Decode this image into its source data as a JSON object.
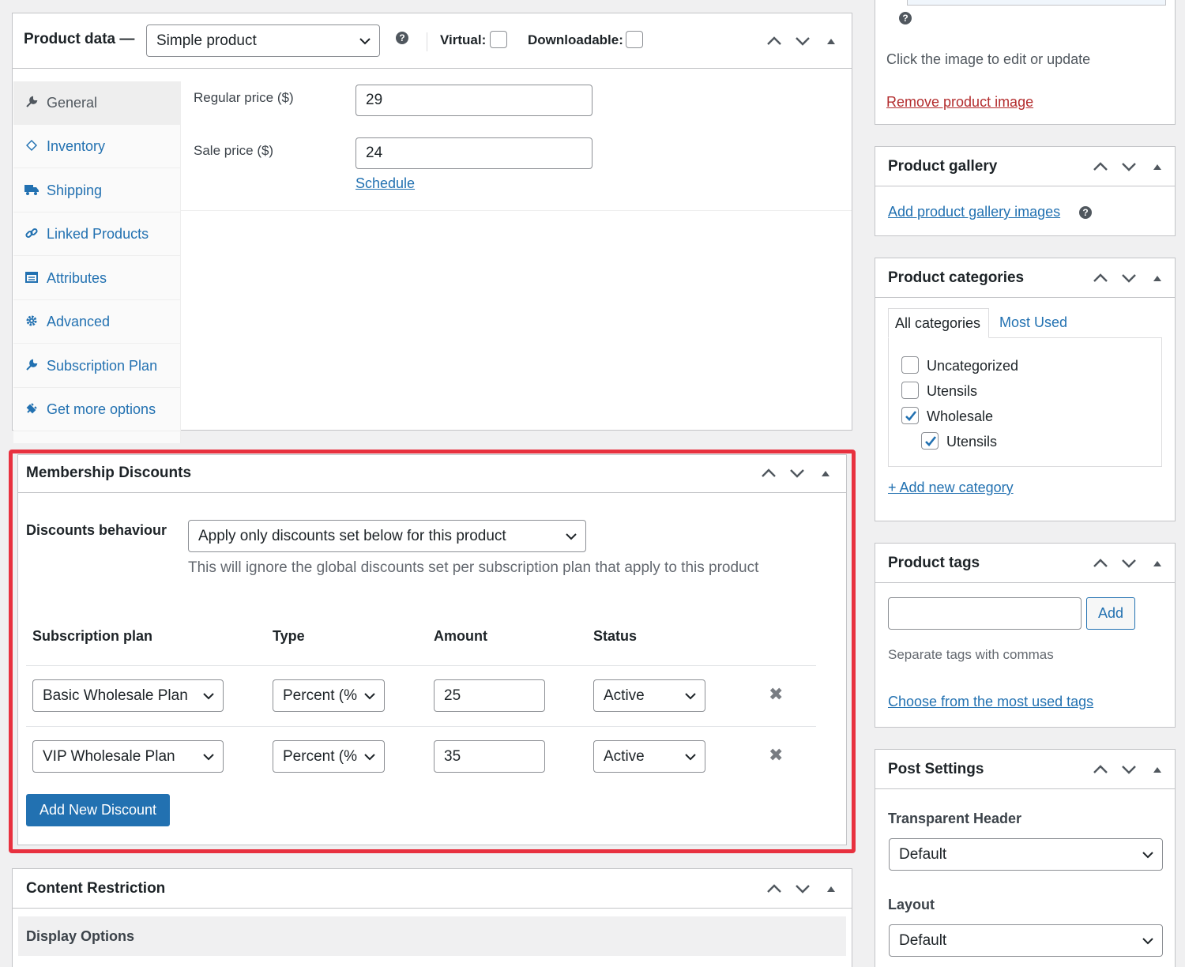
{
  "product_data": {
    "title": "Product data —",
    "type_select": "Simple product",
    "virtual_label": "Virtual:",
    "downloadable_label": "Downloadable:",
    "tabs": [
      {
        "label": "General",
        "icon": "wrench-icon"
      },
      {
        "label": "Inventory",
        "icon": "tag-icon"
      },
      {
        "label": "Shipping",
        "icon": "truck-icon"
      },
      {
        "label": "Linked Products",
        "icon": "link-icon"
      },
      {
        "label": "Attributes",
        "icon": "table-icon"
      },
      {
        "label": "Advanced",
        "icon": "gear-icon"
      },
      {
        "label": "Subscription Plan",
        "icon": "wrench-icon"
      },
      {
        "label": "Get more options",
        "icon": "plugin-icon"
      }
    ],
    "regular_price_label": "Regular price ($)",
    "regular_price_value": "29",
    "sale_price_label": "Sale price ($)",
    "sale_price_value": "24",
    "schedule_link": "Schedule"
  },
  "membership": {
    "title": "Membership Discounts",
    "behaviour_label": "Discounts behaviour",
    "behaviour_select": "Apply only discounts set below for this product",
    "behaviour_hint": "This will ignore the global discounts set per subscription plan that apply to this product",
    "columns": [
      "Subscription plan",
      "Type",
      "Amount",
      "Status"
    ],
    "rows": [
      {
        "plan": "Basic Wholesale Plan",
        "type": "Percent (%",
        "amount": "25",
        "status": "Active"
      },
      {
        "plan": "VIP Wholesale Plan",
        "type": "Percent (%",
        "amount": "35",
        "status": "Active"
      }
    ],
    "remove_glyph": "✖",
    "add_button": "Add New Discount"
  },
  "content_restriction": {
    "title": "Content Restriction",
    "display_options": "Display Options"
  },
  "product_image": {
    "hint": "Click the image to edit or update",
    "remove_link": "Remove product image"
  },
  "gallery": {
    "title": "Product gallery",
    "add_link": "Add product gallery images"
  },
  "categories": {
    "title": "Product categories",
    "tab_all": "All categories",
    "tab_most_used": "Most Used",
    "items": [
      {
        "label": "Uncategorized",
        "checked": false,
        "indent": 0
      },
      {
        "label": "Utensils",
        "checked": false,
        "indent": 0
      },
      {
        "label": "Wholesale",
        "checked": true,
        "indent": 0
      },
      {
        "label": "Utensils",
        "checked": true,
        "indent": 1
      }
    ],
    "add_link": "+ Add new category"
  },
  "tags": {
    "title": "Product tags",
    "input_value": "",
    "add_button": "Add",
    "hint": "Separate tags with commas",
    "choose_link": "Choose from the most used tags"
  },
  "post_settings": {
    "title": "Post Settings",
    "header_label": "Transparent Header",
    "header_select": "Default",
    "layout_label": "Layout",
    "layout_select": "Default"
  },
  "colors": {
    "accent": "#2271b1",
    "highlight_border": "#e8313f",
    "danger": "#b32d2e"
  }
}
